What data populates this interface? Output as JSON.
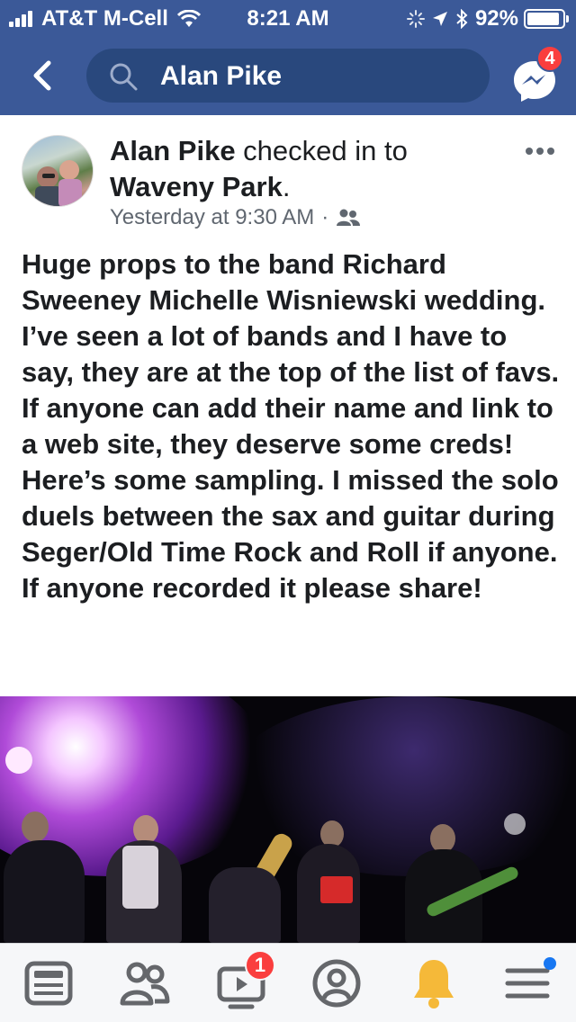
{
  "status_bar": {
    "carrier": "AT&T M-Cell",
    "time": "8:21 AM",
    "battery_percent": "92%",
    "battery_level": 0.92
  },
  "nav": {
    "search_query": "Alan Pike",
    "messenger_badge": "4",
    "icons": [
      "back-icon",
      "search-icon",
      "messenger-icon"
    ]
  },
  "post": {
    "author": "Alan Pike",
    "action_text": " checked in to ",
    "place": "Waveny Park",
    "place_suffix": ".",
    "timestamp": "Yesterday at 9:30 AM",
    "separator": "·",
    "audience_icon": "friends-icon",
    "body_part1": "Huge props to the band Richard Sweeney ",
    "body_tag": "Michelle Wisniewski",
    "body_part2": " wedding. I’ve seen a lot of bands and I have to say, they are at the top of the list of favs. If anyone can add their name and link to a web site, they deserve some creds! Here’s some sampling. I missed the solo duels between the sax and guitar during Seger/Old Time Rock and Roll if anyone. If anyone recorded it please share!"
  },
  "tabbar": {
    "items": [
      "news-feed-icon",
      "friends-icon",
      "watch-icon",
      "profile-icon",
      "notifications-icon",
      "menu-icon"
    ],
    "watch_badge": "1"
  },
  "colors": {
    "header_blue": "#3b5998",
    "search_bg": "#29487d",
    "badge_red": "#fa3e3e",
    "text": "#1c1e21",
    "meta_gray": "#606770",
    "bell_yellow": "#f5b939",
    "menu_dot_blue": "#1877f2"
  }
}
